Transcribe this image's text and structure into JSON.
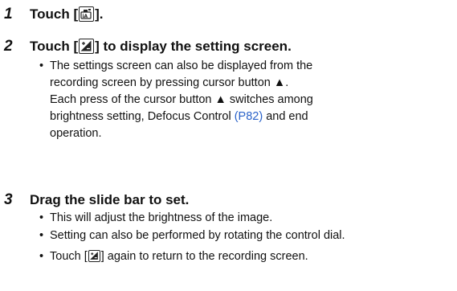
{
  "step1": {
    "number": "1",
    "prefix": "Touch [",
    "suffix": "].",
    "icon": "intelligent-auto-icon"
  },
  "step2": {
    "number": "2",
    "prefix": "Touch [",
    "suffix": "] to display the setting screen.",
    "icon": "exposure-compensation-icon",
    "bullet": {
      "line1": "The settings screen can also be displayed from the",
      "line2": "recording screen by pressing cursor button ▲.",
      "line3": "Each press of the cursor button ▲ switches among",
      "line4_before": "brightness setting, Defocus Control ",
      "line4_link": "(P82)",
      "line4_after": " and end",
      "line5": "operation."
    }
  },
  "step3": {
    "number": "3",
    "title": "Drag the slide bar to set.",
    "bullets": [
      "This will adjust the brightness of the image.",
      "Setting can also be performed by rotating the control dial."
    ],
    "last_bullet_prefix": "Touch [",
    "last_bullet_suffix": "] again to return to the recording screen.",
    "icon": "exposure-compensation-icon"
  },
  "colors": {
    "text": "#111111",
    "link": "#2a62c9",
    "background": "#ffffff"
  }
}
